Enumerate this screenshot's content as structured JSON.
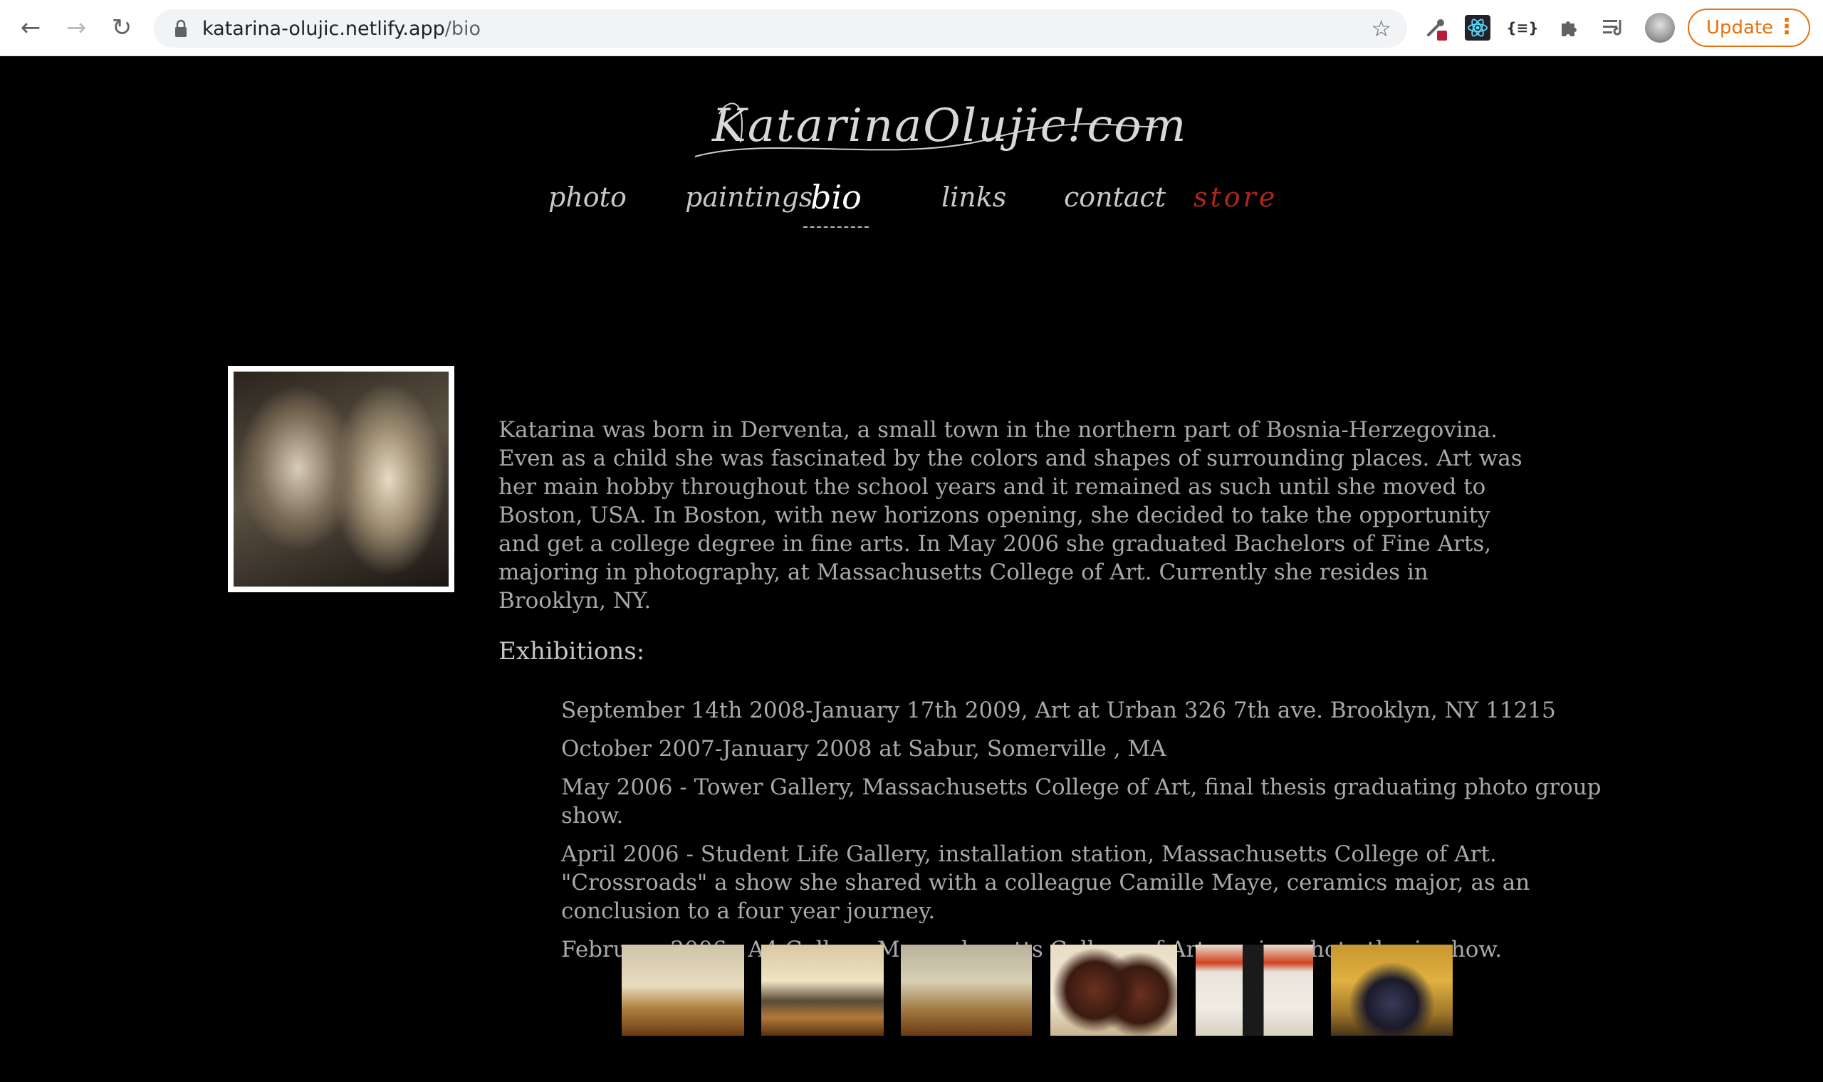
{
  "browser": {
    "url_host": "katarina-olujic.netlify.app",
    "url_path": "/bio",
    "update_label": "Update",
    "extensions": [
      "eyedropper-extension-icon",
      "react-devtools-icon",
      "json-viewer-icon",
      "puzzle-icon",
      "reading-list-icon"
    ]
  },
  "site": {
    "logo_text": "KatarinaOlujic!com",
    "nav": [
      {
        "label": "photo"
      },
      {
        "label": "paintings"
      },
      {
        "label": "bio"
      },
      {
        "label": "links"
      },
      {
        "label": "contact"
      },
      {
        "label": "store"
      }
    ],
    "active_nav": "bio",
    "store_color": "#b0251b"
  },
  "bio": {
    "text": "Katarina was born in Derventa, a small town in the northern part of Bosnia-Herzegovina. Even as a child she was fascinated by the colors and shapes of surrounding places. Art was her main hobby throughout the school years and it remained as such until she moved to Boston, USA. In Boston, with new horizons opening, she decided to take the opportunity and get a college degree in fine arts. In May 2006 she graduated Bachelors of Fine Arts, majoring in photography, at Massachusetts College of Art. Currently she resides in Brooklyn, NY."
  },
  "exhibitions": {
    "title": "Exhibitions:",
    "items": [
      "September 14th 2008-January 17th 2009, Art at Urban 326 7th ave. Brooklyn, NY 11215",
      "October 2007-January 2008 at Sabur, Somerville , MA",
      "May 2006 - Tower Gallery, Massachusetts College of Art, final thesis graduating photo group show.",
      "April 2006 - Student Life Gallery, installation station, Massachusetts College of Art. \"Crossroads\" a show she shared with a colleague Camille Maye, ceramics major, as an conclusion to a four year journey.",
      "February 2006 - A4 Gallery, Massachusetts College of Art, senior photo thesis show."
    ]
  },
  "gallery": {
    "count": 6
  }
}
